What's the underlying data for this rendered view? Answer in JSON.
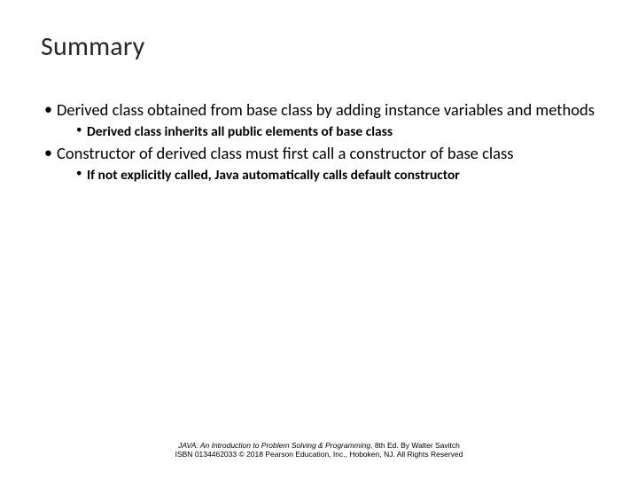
{
  "title": "Summary",
  "bullets": {
    "b1": "Derived class obtained from base class by adding instance variables and methods",
    "b1_sub": "Derived class inherits all public elements of base class",
    "b2": "Constructor of derived class must first call a constructor of base class",
    "b2_sub": "If not explicitly called, Java automatically calls default constructor"
  },
  "footer": {
    "book_title": "JAVA: An Introduction to Problem Solving & Programming",
    "edition": ", 8th Ed. By Walter Savitch",
    "line2": "ISBN 0134462033 © 2018 Pearson Education, Inc., Hoboken, NJ. All Rights Reserved"
  }
}
